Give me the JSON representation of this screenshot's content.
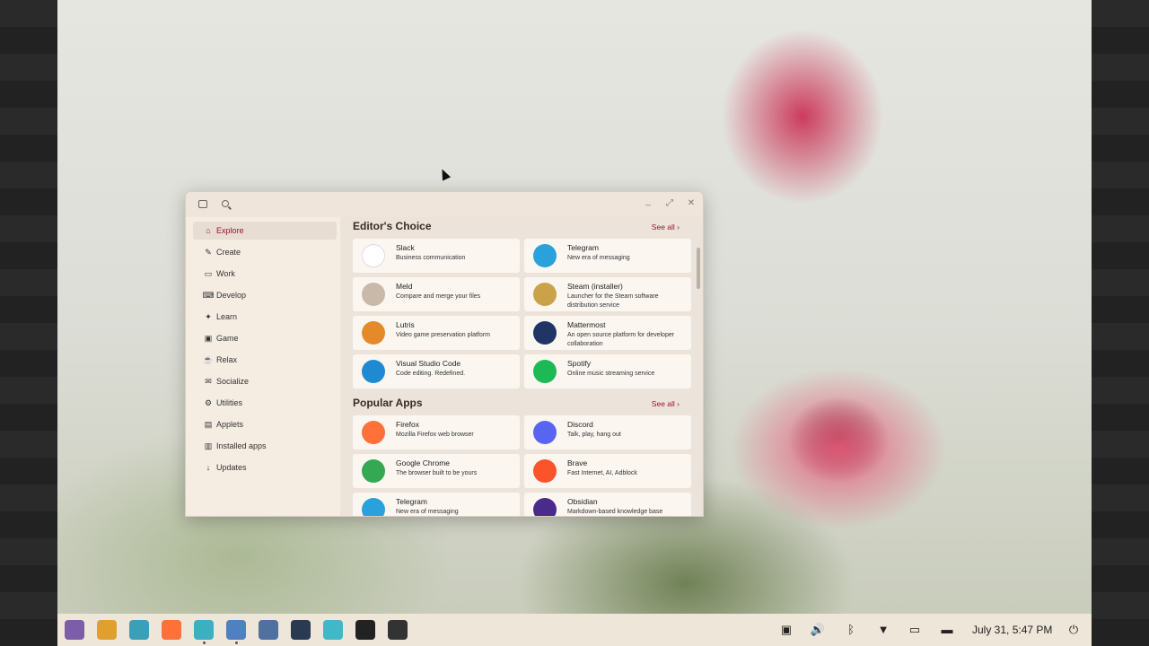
{
  "window": {
    "sidebar": [
      {
        "label": "Explore",
        "icon": "home-icon",
        "glyph": "⌂",
        "active": true
      },
      {
        "label": "Create",
        "icon": "palette-icon",
        "glyph": "✎"
      },
      {
        "label": "Work",
        "icon": "monitor-icon",
        "glyph": "▭"
      },
      {
        "label": "Develop",
        "icon": "code-icon",
        "glyph": "⌨"
      },
      {
        "label": "Learn",
        "icon": "learn-icon",
        "glyph": "✦"
      },
      {
        "label": "Game",
        "icon": "gamepad-icon",
        "glyph": "▣"
      },
      {
        "label": "Relax",
        "icon": "relax-icon",
        "glyph": "☕"
      },
      {
        "label": "Socialize",
        "icon": "chat-icon",
        "glyph": "✉"
      },
      {
        "label": "Utilities",
        "icon": "utilities-icon",
        "glyph": "⚙"
      },
      {
        "label": "Applets",
        "icon": "applets-icon",
        "glyph": "▤"
      },
      {
        "label": "Installed apps",
        "icon": "installed-icon",
        "glyph": "▥"
      },
      {
        "label": "Updates",
        "icon": "download-icon",
        "glyph": "↓"
      }
    ],
    "editors_choice": {
      "title": "Editor's Choice",
      "see_all": "See all",
      "apps": [
        {
          "name": "Slack",
          "desc": "Business communication",
          "icon": "slack-icon",
          "color": "#ffffff"
        },
        {
          "name": "Telegram",
          "desc": "New era of messaging",
          "icon": "telegram-icon",
          "color": "#2aa1da"
        },
        {
          "name": "Meld",
          "desc": "Compare and merge your files",
          "icon": "meld-icon",
          "color": "#c9b9a8"
        },
        {
          "name": "Steam (installer)",
          "desc": "Launcher for the Steam software distribution service",
          "icon": "steam-icon",
          "color": "#c9a24a"
        },
        {
          "name": "Lutris",
          "desc": "Video game preservation platform",
          "icon": "lutris-icon",
          "color": "#e58a2a"
        },
        {
          "name": "Mattermost",
          "desc": "An open source platform for developer collaboration",
          "icon": "mattermost-icon",
          "color": "#1e3566"
        },
        {
          "name": "Visual Studio Code",
          "desc": "Code editing. Redefined.",
          "icon": "vscode-icon",
          "color": "#1f8ad2"
        },
        {
          "name": "Spotify",
          "desc": "Online music streaming service",
          "icon": "spotify-icon",
          "color": "#1db954"
        }
      ]
    },
    "popular_apps": {
      "title": "Popular Apps",
      "see_all": "See all",
      "apps": [
        {
          "name": "Firefox",
          "desc": "Mozilla Firefox web browser",
          "icon": "firefox-icon",
          "color": "#ff7139"
        },
        {
          "name": "Discord",
          "desc": "Talk, play, hang out",
          "icon": "discord-icon",
          "color": "#5865f2"
        },
        {
          "name": "Google Chrome",
          "desc": "The browser built to be yours",
          "icon": "chrome-icon",
          "color": "#34a853"
        },
        {
          "name": "Brave",
          "desc": "Fast Internet, AI, Adblock",
          "icon": "brave-icon",
          "color": "#fb542b"
        },
        {
          "name": "Telegram",
          "desc": "New era of messaging",
          "icon": "telegram-icon",
          "color": "#2aa1da"
        },
        {
          "name": "Obsidian",
          "desc": "Markdown-based knowledge base",
          "icon": "obsidian-icon",
          "color": "#4a2a8a"
        }
      ]
    }
  },
  "taskbar": {
    "apps": [
      {
        "icon": "launcher-icon",
        "color": "#7b5ea7"
      },
      {
        "icon": "app-grid-icon",
        "color": "#e0a030"
      },
      {
        "icon": "workspaces-icon",
        "color": "#3aa0b8"
      },
      {
        "icon": "firefox-icon",
        "color": "#ff7139"
      },
      {
        "icon": "files-icon",
        "color": "#3ab0c0",
        "running": true
      },
      {
        "icon": "store-icon",
        "color": "#5080c0",
        "running": true
      },
      {
        "icon": "text-editor-icon",
        "color": "#5070a0"
      },
      {
        "icon": "terminal-icon",
        "color": "#2a3a50"
      },
      {
        "icon": "settings-icon",
        "color": "#40b8c8"
      },
      {
        "icon": "obs-icon",
        "color": "#222222"
      },
      {
        "icon": "screenshot-icon",
        "color": "#333333"
      }
    ],
    "clock": "July 31, 5:47 PM"
  }
}
